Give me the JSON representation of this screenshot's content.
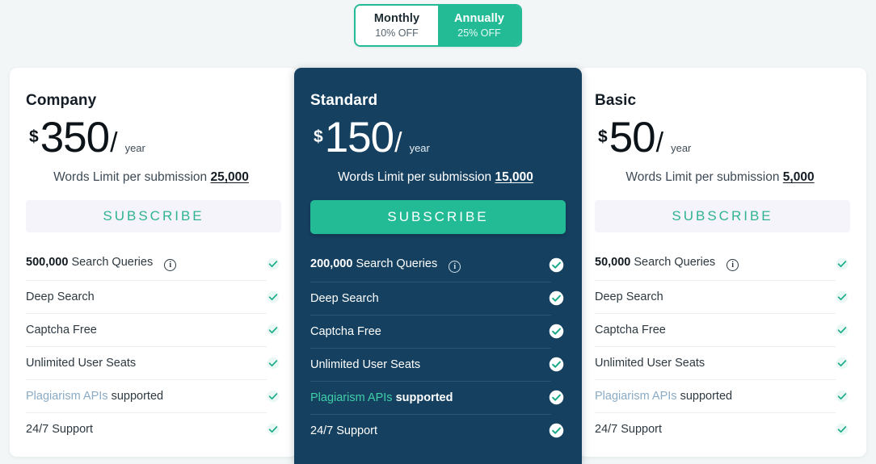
{
  "billing_toggle": {
    "options": [
      {
        "label": "Monthly",
        "discount": "10% OFF",
        "active": false
      },
      {
        "label": "Annually",
        "discount": "25% OFF",
        "active": true
      }
    ]
  },
  "colors": {
    "accent_green": "#23ba96",
    "dark_card": "#15405f",
    "page_background": "#f2f6f6",
    "subscribe_light_bg": "#f5f4fb",
    "link_blue": "#8aabc4"
  },
  "plans": [
    {
      "name": "Company",
      "currency": "$",
      "amount": "350",
      "slash": "/",
      "period": "year",
      "words_limit_label": "Words Limit per submission",
      "words_limit_value": "25,000",
      "subscribe_label": "SUBSCRIBE",
      "features": [
        {
          "strong": "500,000",
          "text": " Search Queries",
          "has_info": true
        },
        {
          "strong": "",
          "text": "Deep Search",
          "has_info": false
        },
        {
          "strong": "",
          "text": "Captcha Free",
          "has_info": false
        },
        {
          "strong": "",
          "text": "Unlimited User Seats",
          "has_info": false
        },
        {
          "link": "Plagiarism APIs",
          "text": " supported",
          "has_info": false
        },
        {
          "strong": "",
          "text": "24/7 Support",
          "has_info": false
        }
      ]
    },
    {
      "name": "Standard",
      "currency": "$",
      "amount": "150",
      "slash": "/",
      "period": "year",
      "words_limit_label": "Words Limit per submission",
      "words_limit_value": "15,000",
      "subscribe_label": "SUBSCRIBE",
      "features": [
        {
          "strong": "200,000",
          "text": " Search Queries",
          "has_info": true
        },
        {
          "strong": "",
          "text": "Deep Search",
          "has_info": false
        },
        {
          "strong": "",
          "text": "Captcha Free",
          "has_info": false
        },
        {
          "strong": "",
          "text": "Unlimited User Seats",
          "has_info": false
        },
        {
          "link": "Plagiarism APIs",
          "text": " supported",
          "has_info": false
        },
        {
          "strong": "",
          "text": "24/7 Support",
          "has_info": false
        }
      ]
    },
    {
      "name": "Basic",
      "currency": "$",
      "amount": "50",
      "slash": "/",
      "period": "year",
      "words_limit_label": "Words Limit per submission",
      "words_limit_value": "5,000",
      "subscribe_label": "SUBSCRIBE",
      "features": [
        {
          "strong": "50,000",
          "text": " Search Queries",
          "has_info": true
        },
        {
          "strong": "",
          "text": "Deep Search",
          "has_info": false
        },
        {
          "strong": "",
          "text": "Captcha Free",
          "has_info": false
        },
        {
          "strong": "",
          "text": "Unlimited User Seats",
          "has_info": false
        },
        {
          "link": "Plagiarism APIs",
          "text": " supported",
          "has_info": false
        },
        {
          "strong": "",
          "text": "24/7 Support",
          "has_info": false
        }
      ]
    }
  ],
  "icons": {
    "info": "i",
    "check": "check-icon"
  }
}
